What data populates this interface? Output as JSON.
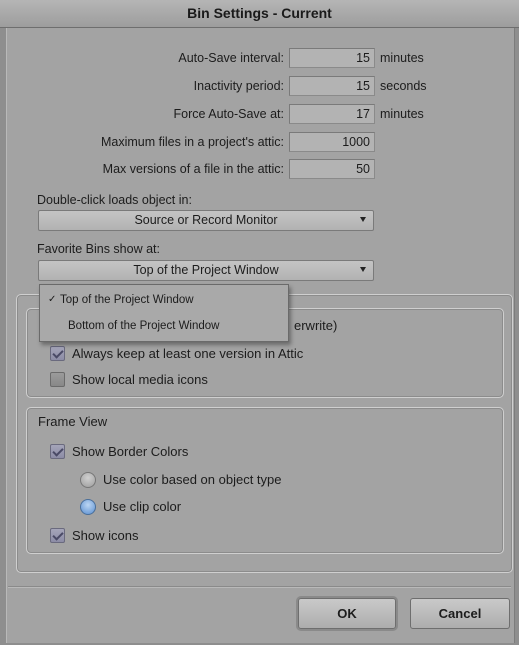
{
  "window": {
    "title": "Bin Settings - Current"
  },
  "autosave": {
    "interval_label": "Auto-Save interval:",
    "interval_value": "15",
    "interval_unit": "minutes",
    "inactivity_label": "Inactivity period:",
    "inactivity_value": "15",
    "inactivity_unit": "seconds",
    "force_label": "Force Auto-Save at:",
    "force_value": "17",
    "force_unit": "minutes"
  },
  "attic": {
    "max_files_label": "Maximum files in a project's attic:",
    "max_files_value": "1000",
    "max_versions_label": "Max versions of a file in the attic:",
    "max_versions_value": "50"
  },
  "double_click": {
    "label": "Double-click loads object in:",
    "value": "Source or Record Monitor"
  },
  "favorite_bins": {
    "label": "Favorite Bins show at:",
    "value": "Top of the Project Window",
    "menu": {
      "items": [
        {
          "label": "Top of the Project Window",
          "checked": true,
          "check_mark": "✓"
        },
        {
          "label": "Bottom of the Project Window",
          "checked": false
        }
      ]
    }
  },
  "general_group": {
    "partial_text": "erwrite)",
    "options": [
      {
        "label": "Always keep at least one version in Attic",
        "checked": true
      },
      {
        "label": "Show local media icons",
        "checked": false
      }
    ]
  },
  "frame_view": {
    "title": "Frame View",
    "show_border_colors": {
      "label": "Show Border Colors",
      "checked": true
    },
    "radios": [
      {
        "label": "Use color based on object type",
        "selected": false
      },
      {
        "label": "Use clip color",
        "selected": true
      }
    ],
    "show_icons": {
      "label": "Show icons",
      "checked": true
    }
  },
  "buttons": {
    "ok": "OK",
    "cancel": "Cancel"
  }
}
